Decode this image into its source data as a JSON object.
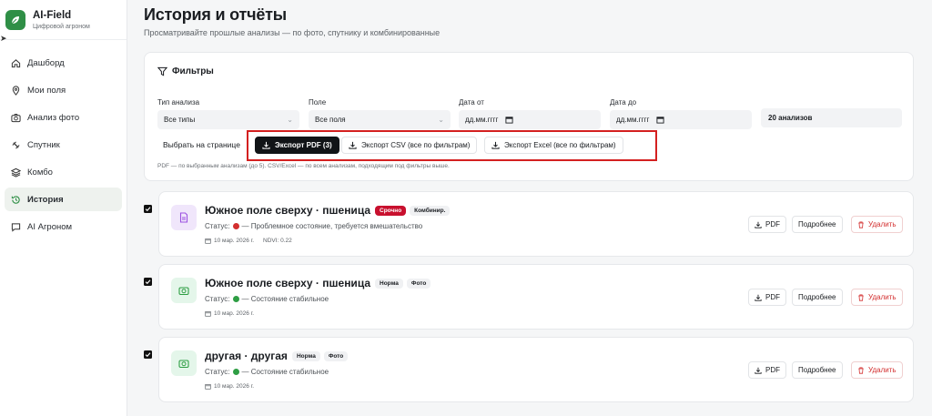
{
  "brand": {
    "name": "AI-Field",
    "subtitle": "Цифровой агроном"
  },
  "sidebar": {
    "items": [
      {
        "label": "Дашборд",
        "icon": "home-icon"
      },
      {
        "label": "Мои поля",
        "icon": "map-pin-icon"
      },
      {
        "label": "Анализ фото",
        "icon": "camera-icon"
      },
      {
        "label": "Спутник",
        "icon": "satellite-icon"
      },
      {
        "label": "Комбо",
        "icon": "layers-icon"
      },
      {
        "label": "История",
        "icon": "history-icon",
        "active": true
      },
      {
        "label": "AI Агроном",
        "icon": "chat-icon"
      }
    ]
  },
  "page": {
    "title": "История и отчёты",
    "subtitle": "Просматривайте прошлые анализы — по фото, спутнику и комбинированные"
  },
  "filters": {
    "heading": "Фильтры",
    "type_label": "Тип анализа",
    "type_value": "Все типы",
    "field_label": "Поле",
    "field_value": "Все поля",
    "date_from_label": "Дата от",
    "date_from_placeholder": "дд.мм.гггг",
    "date_to_label": "Дата до",
    "date_to_placeholder": "дд.мм.гггг",
    "count": "20 анализов",
    "select_on_page": "Выбрать на странице",
    "export_pdf": "Экспорт PDF (3)",
    "export_csv": "Экспорт CSV (все по фильтрам)",
    "export_excel": "Экспорт Excel (все по фильтрам)",
    "note": "PDF — по выбранным анализам (до 5). CSV/Excel — по всем анализам, подходящим под фильтры выше."
  },
  "analyses": [
    {
      "title": "Южное поле сверху · пшеница",
      "badges": [
        "Срочно",
        "Комбинир."
      ],
      "status_prefix": "Статус:",
      "status_text": "— Проблемное состояние, требуется вмешательство",
      "date": "10 мар. 2026 г.",
      "ndvi": "NDVI: 0.22",
      "checked": true
    },
    {
      "title": "Южное поле сверху · пшеница",
      "badges": [
        "Норма",
        "Фото"
      ],
      "status_prefix": "Статус:",
      "status_text": "— Состояние стабильное",
      "date": "10 мар. 2026 г.",
      "checked": true
    },
    {
      "title": "другая · другая",
      "badges": [
        "Норма",
        "Фото"
      ],
      "status_prefix": "Статус:",
      "status_text": "— Состояние стабильное",
      "date": "10 мар. 2026 г.",
      "checked": true
    }
  ],
  "card_actions": {
    "pdf": "PDF",
    "details": "Подробнее",
    "delete": "Удалить"
  },
  "colors": {
    "accent": "#2f8f46",
    "danger": "#d32f2f",
    "urgent": "#c8102e",
    "highlight_box": "#d42020"
  }
}
